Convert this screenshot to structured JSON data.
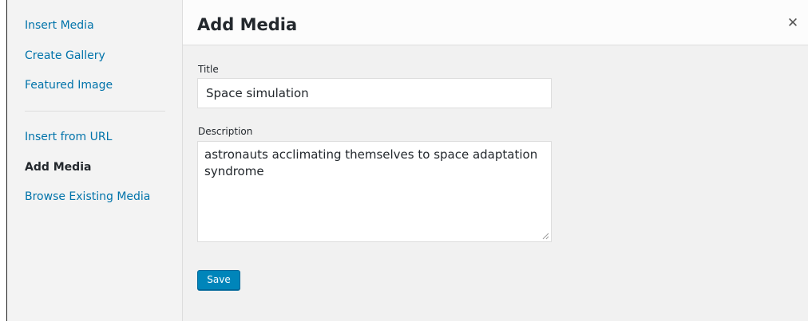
{
  "menu": {
    "items": [
      {
        "label": "Insert Media"
      },
      {
        "label": "Create Gallery"
      },
      {
        "label": "Featured Image"
      },
      {
        "label": "Insert from URL"
      },
      {
        "label": "Add Media",
        "active": true
      },
      {
        "label": "Browse Existing Media"
      }
    ]
  },
  "header": {
    "title": "Add Media",
    "close_icon": "close-icon"
  },
  "form": {
    "title_label": "Title",
    "title_value": "Space simulation",
    "description_label": "Description",
    "description_value": "astronauts acclimating themselves to space adaptation syndrome",
    "save_label": "Save"
  },
  "colors": {
    "link": "#0073aa",
    "primary_button": "#0085ba",
    "content_bg": "#f1f1f1",
    "menu_bg": "#f3f3f3"
  }
}
